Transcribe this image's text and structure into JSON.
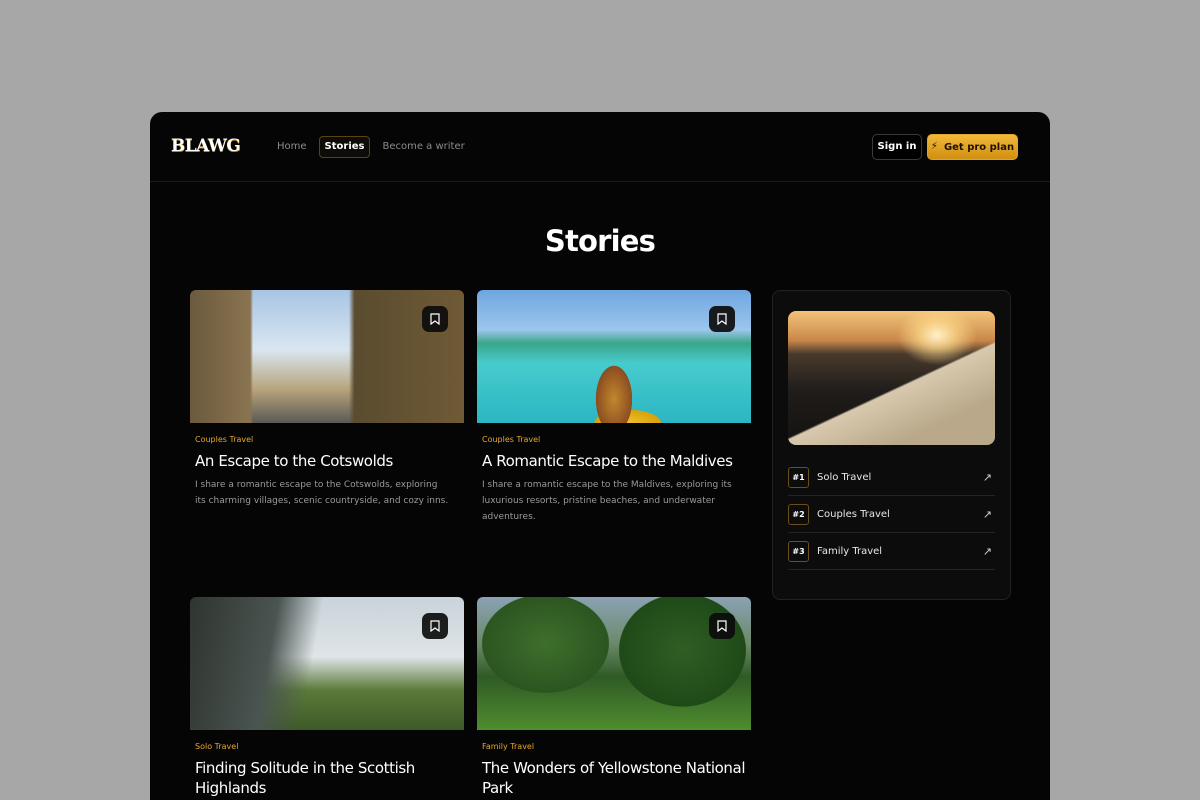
{
  "brand": {
    "logo": "BLAWG",
    "accent": "#e8a82a"
  },
  "nav": [
    {
      "label": "Home",
      "active": false
    },
    {
      "label": "Stories",
      "active": true
    },
    {
      "label": "Become a writer",
      "active": false
    }
  ],
  "header": {
    "signin_label": "Sign in",
    "pro_label": "Get pro plan",
    "pro_icon": "bolt-icon"
  },
  "page": {
    "title": "Stories"
  },
  "stories": [
    {
      "category": "Couples Travel",
      "title": "An Escape to the Cotswolds",
      "description": "I share a romantic escape to the Cotswolds, exploring its charming villages, scenic countryside, and cozy inns."
    },
    {
      "category": "Couples Travel",
      "title": "A Romantic Escape to the Maldives",
      "description": "I share a romantic escape to the Maldives, exploring its luxurious resorts, pristine beaches, and underwater adventures."
    },
    {
      "category": "Solo Travel",
      "title": "Finding Solitude in the Scottish Highlands",
      "description": ""
    },
    {
      "category": "Family Travel",
      "title": "The Wonders of Yellowstone National Park",
      "description": ""
    }
  ],
  "sidebar": {
    "rankings": [
      {
        "rank": "#1",
        "label": "Solo Travel"
      },
      {
        "rank": "#2",
        "label": "Couples Travel"
      },
      {
        "rank": "#3",
        "label": "Family Travel"
      }
    ]
  }
}
